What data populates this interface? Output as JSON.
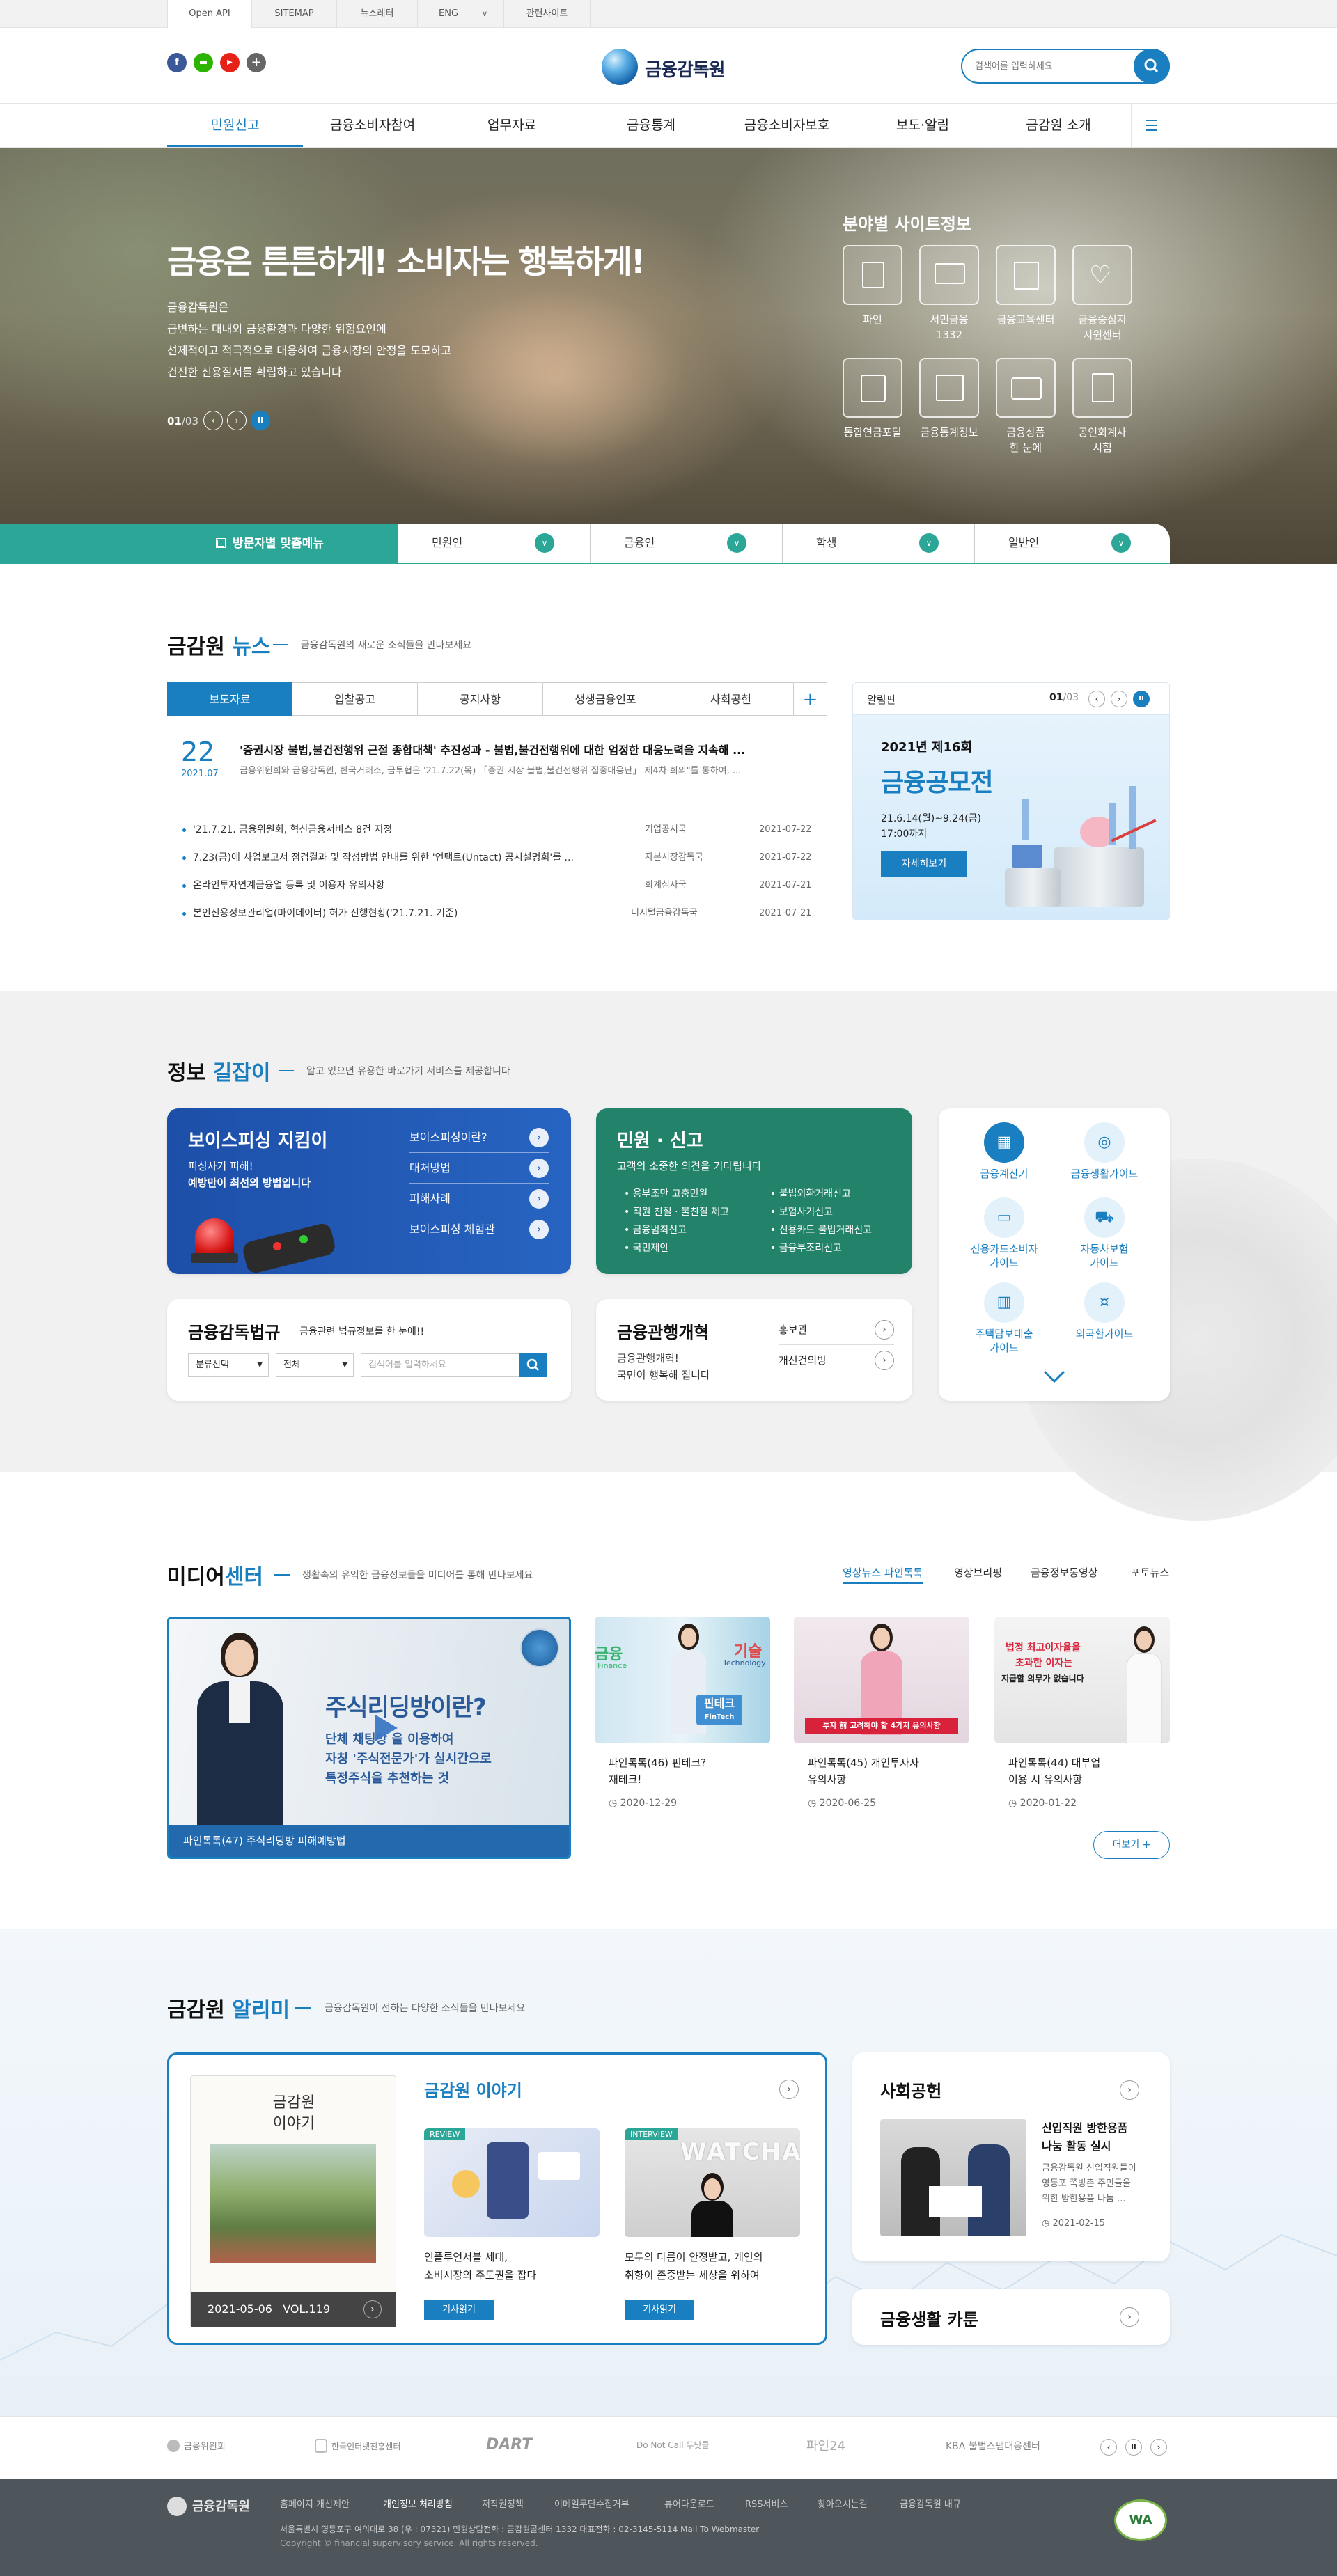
{
  "util": {
    "tabs": [
      "Open API",
      "SITEMAP",
      "뉴스레터",
      "ENG",
      "관련사이트"
    ]
  },
  "header": {
    "sns": [
      "f",
      "▬",
      "▶",
      "+"
    ],
    "logo_text": "금융감독원",
    "search_placeholder": "검색어를 입력하세요"
  },
  "gnb": [
    "민원신고",
    "금융소비자참여",
    "업무자료",
    "금융통계",
    "금융소비자보호",
    "보도·알림",
    "금감원 소개"
  ],
  "hero": {
    "headline": "금융은 튼튼하게! 소비자는 행복하게!",
    "lines": [
      "금융감독원은",
      "급변하는 대내외 금융환경과 다양한 위험요인에",
      "선제적이고 적극적으로 대응하여 금융시장의 안정을 도모하고",
      "건전한 신용질서를 확립하고 있습니다"
    ],
    "counter_current": "01",
    "counter_total": "/03",
    "site_title": "분야별 사이트정보",
    "sites": [
      "파인",
      "서민금융\n1332",
      "금융교육센터",
      "금융중심지\n지원센터",
      "통합연금포털",
      "금융통계정보",
      "금융상품\n한 눈에",
      "공인회계사\n시험"
    ],
    "visitor_label": "방문자별 맞춤메뉴",
    "visitor_items": [
      "민원인",
      "금융인",
      "학생",
      "일반인"
    ]
  },
  "news": {
    "title_a": "금감원",
    "title_b": "뉴스",
    "desc": "금융감독원의 새로운 소식들을 만나보세요",
    "tabs": [
      "보도자료",
      "입찰공고",
      "공지사항",
      "생생금융인포",
      "사회공헌"
    ],
    "plus": "+",
    "featured": {
      "day": "22",
      "ym": "2021.07",
      "title": "'증권시장 불법,불건전행위 근절 종합대책' 추진성과 - 불법,불건전행위에 대한 엄정한 대응노력을 지속해 ...",
      "summary": "금융위원회와 금융감독원, 한국거래소, 금투협은 '21.7.22(목) 「증권 시장 불법,불건전행위 집중대응단」 제4차 회의\"를 통하여, ..."
    },
    "rows": [
      {
        "title": "'21.7.21. 금융위원회, 혁신금융서비스 8건 지정",
        "dept": "기업공시국",
        "date": "2021-07-22"
      },
      {
        "title": "7.23(금)에 사업보고서 점검결과 및 작성방법 안내를 위한 '언택트(Untact) 공시설명회'를 ...",
        "dept": "자본시장감독국",
        "date": "2021-07-22"
      },
      {
        "title": "온라인투자연계금융업 등록 및 이용자 유의사항",
        "dept": "회계심사국",
        "date": "2021-07-21"
      },
      {
        "title": "본인신용정보관리업(마이데이터) 허가 진행현황('21.7.21. 기준)",
        "dept": "디지털금융감독국",
        "date": "2021-07-21"
      }
    ],
    "notice": {
      "label": "알림판",
      "counter_current": "01",
      "counter_total": "/03",
      "sub": "2021년 제16회",
      "title": "금융공모전",
      "period": "21.6.14(월)~9.24(금)",
      "time": "17:00까지",
      "btn": "자세히보기"
    }
  },
  "info": {
    "title_a": "정보",
    "title_b": "길잡이",
    "desc": "알고 있으면 유용한 바로가기 서비스를 제공합니다",
    "phishing": {
      "title": "보이스피싱 지킴이",
      "line1": "피싱사기 피해!",
      "line2": "예방만이 최선의 방법입니다",
      "links": [
        "보이스피싱이란?",
        "대처방법",
        "피해사례",
        "보이스피싱 체험관"
      ]
    },
    "complaint": {
      "title": "민원 · 신고",
      "desc": "고객의 소중한 의견을 기다립니다",
      "left": [
        "용부조만 고충민원",
        "직원 친절 · 불친절 제고",
        "금융범죄신고",
        "국민제안"
      ],
      "right": [
        "불법외환거래신고",
        "보험사기신고",
        "신용카드 불법거래신고",
        "금융부조리신고"
      ]
    },
    "guides": [
      "금융계산기",
      "금융생활가이드",
      "신용카드소비자\n가이드",
      "자동차보험\n가이드",
      "주택담보대출\n가이드",
      "외국환가이드"
    ],
    "law": {
      "title": "금융감독법규",
      "desc": "금융관련 법규정보를 한 눈에!!",
      "select1": "분류선택",
      "select2": "전체",
      "placeholder": "검색어를 입력하세요"
    },
    "reform": {
      "title": "금융관행개혁",
      "line1": "금융관행개혁!",
      "line2": "국민이 행복해 집니다",
      "links": [
        "홍보관",
        "개선건의방"
      ]
    }
  },
  "media": {
    "title_a": "미디어",
    "title_b": "센터",
    "desc": "생활속의 유익한 금융정보들을 미디어를 통해 만나보세요",
    "tabs": [
      "영상뉴스 파인톡톡",
      "영상브리핑",
      "금융정보동영상",
      "포토뉴스"
    ],
    "main": {
      "caption": "파인톡톡(47) 주식리딩방 피해예방법",
      "overlay_title": "주식리딩방이란?",
      "overlay_l1": "단체 채팅방 을 이용하여",
      "overlay_l2": "자칭 '주식전문가'가 실시간으로",
      "overlay_l3": "특정주식을 추천하는 것"
    },
    "items": [
      {
        "title": "파인톡톡(46) 핀테크?\n재테크!",
        "date": "2020-12-29",
        "tag1": "금융",
        "tag2": "Finance",
        "tag3": "기술",
        "tag4": "Technology",
        "tag5": "핀테크",
        "tag6": "FinTech"
      },
      {
        "title": "파인톡톡(45) 개인투자자\n유의사항",
        "date": "2020-06-25",
        "banner": "투자 前 고려해야 할 4가지 유의사항"
      },
      {
        "title": "파인톡톡(44) 대부업\n이용 시 유의사항",
        "date": "2020-01-22",
        "banner1": "법정 최고이자율을",
        "banner2": "초과한 이자는",
        "banner3": "지급할 의무가 없습니다"
      }
    ],
    "more": "더보기 +"
  },
  "alimi": {
    "title_a": "금감원",
    "title_b": "알리미",
    "desc": "금융감독원이 전하는 다양한 소식들을 만나보세요",
    "story_title": "금감원 이야기",
    "book_title": "금감원\n이야기",
    "book_date": "2021-05-06",
    "book_vol": "VOL.119",
    "articles": [
      {
        "badge": "REVIEW",
        "title": "인플루언서블 세대,\n소비시장의 주도권을 잡다",
        "btn": "기사읽기"
      },
      {
        "badge": "INTERVIEW",
        "title": "모두의 다름이 안정받고, 개인의\n취향이 존중받는 세상을 위하여",
        "btn": "기사읽기",
        "sign": "WATCHA"
      }
    ],
    "social": {
      "title": "사회공헌",
      "head": "신입직원 방한용품\n나눔 활동 실시",
      "body": "금융감독원 신입직원들이\n영등포 쪽방촌 주민들을\n위한 방한용품 나눔 ...",
      "date": "2021-02-15"
    },
    "cartoon": "금융생활 카툰"
  },
  "partners": [
    "금융위원회",
    "한국인터넷진흥센터",
    "DART",
    "Do Not Call 두낫콜",
    "파인24",
    "KBA 불법스팸대응센터"
  ],
  "footer": {
    "logo": "금융감독원",
    "links": [
      "홈페이지 개선제안",
      "개인정보 처리방침",
      "저작권정책",
      "이메일무단수집거부",
      "뷰어다운로드",
      "RSS서비스",
      "찾아오시는길",
      "금융감독원 내규"
    ],
    "address": "서울특별시 영등포구 여의대로 38 (우 : 07321) 민원상담전화 : 금감원콜센터 1332 대표전화 : 02-3145-5114 Mail To Webmaster",
    "copyright": "Copyright © financial supervisory service. All rights reserved.",
    "badge": "WA"
  },
  "colors": {
    "primary": "#1a7fc1",
    "teal": "#2ba697",
    "navy": "#1d4fa8",
    "green": "#23836a",
    "footer_bg": "#4e555b"
  }
}
